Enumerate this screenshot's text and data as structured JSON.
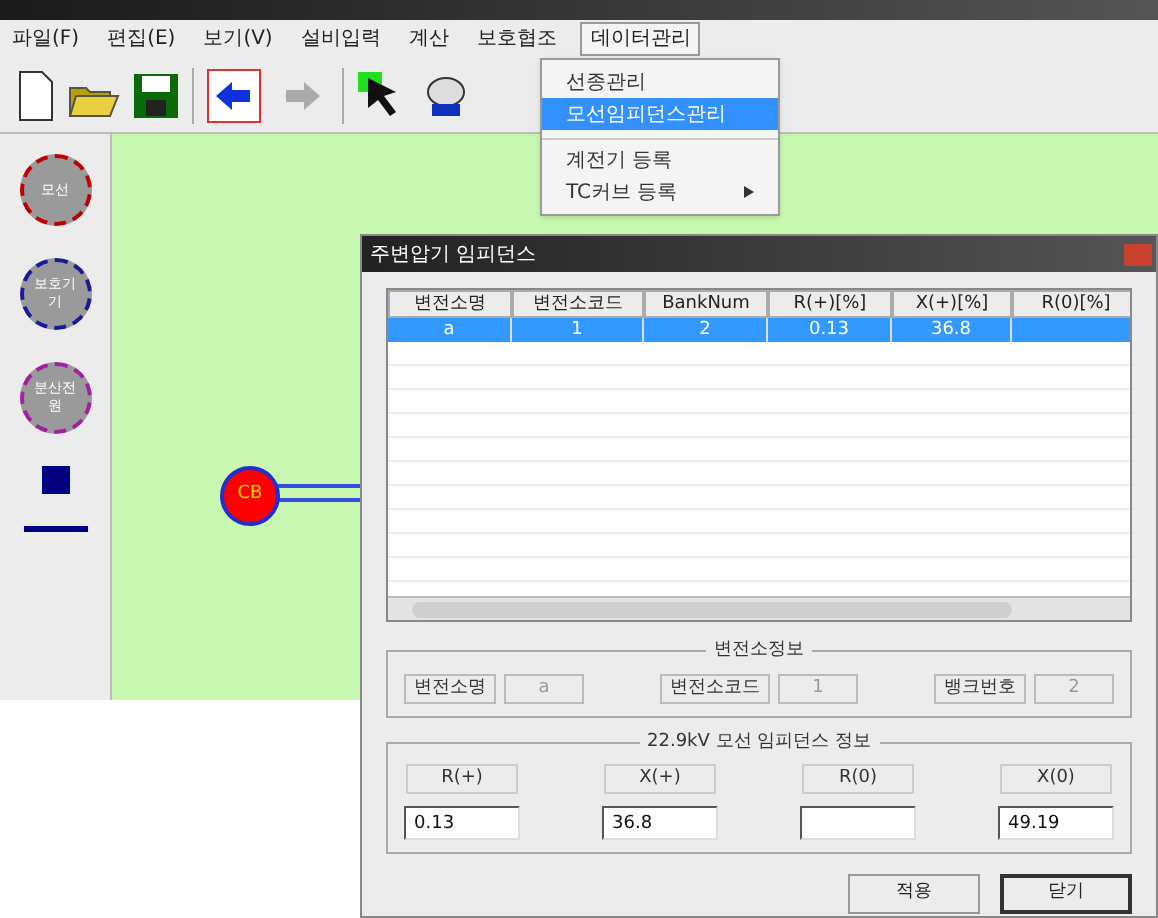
{
  "menu_bar": [
    {
      "label": "파일(F)",
      "selected": false
    },
    {
      "label": "편집(E)",
      "selected": false
    },
    {
      "label": "보기(V)",
      "selected": false
    },
    {
      "label": "설비입력",
      "selected": false
    },
    {
      "label": "계산",
      "selected": false
    },
    {
      "label": "보호협조",
      "selected": false
    },
    {
      "label": "데이터관리",
      "selected": true
    }
  ],
  "dropdown": [
    {
      "label": "선종관리",
      "selected": false,
      "submenu": false
    },
    {
      "label": "모선임피던스관리",
      "selected": true,
      "submenu": false
    },
    {
      "label": "계전기 등록",
      "selected": false,
      "submenu": false
    },
    {
      "label": "TC커브 등록",
      "selected": false,
      "submenu": true
    }
  ],
  "palette": [
    {
      "kind": "circle",
      "label": "모선",
      "color": "#c00000"
    },
    {
      "kind": "circle",
      "label": "보호기기",
      "color": "#1a1a9a"
    },
    {
      "kind": "circle",
      "label": "분산전원",
      "color": "#a020a0"
    },
    {
      "kind": "square"
    },
    {
      "kind": "line"
    }
  ],
  "canvas": {
    "node": "CB"
  },
  "dialog": {
    "title": "주변압기 임피던스",
    "table": {
      "columns": [
        "변전소명",
        "변전소코드",
        "BankNum",
        "R(+)[%]",
        "X(+)[%]",
        "R(0)[%]"
      ],
      "rows": [
        {
          "cells": [
            "a",
            "1",
            "2",
            "0.13",
            "36.8",
            ""
          ],
          "selected": true
        }
      ]
    },
    "station_group": {
      "title": "변전소정보",
      "fields": [
        {
          "label": "변전소명",
          "value": "a",
          "disabled": true
        },
        {
          "label": "변전소코드",
          "value": "1",
          "disabled": true
        },
        {
          "label": "뱅크번호",
          "value": "2",
          "disabled": true
        }
      ]
    },
    "impedance_group": {
      "title": "22.9kV 모선 임피던스 정보",
      "fields": [
        {
          "label": "R(+)",
          "value": "0.13"
        },
        {
          "label": "X(+)",
          "value": "36.8"
        },
        {
          "label": "R(0)"
        },
        {
          "label": "X(0)",
          "value": "49.19"
        }
      ]
    },
    "buttons": [
      {
        "label": "적용",
        "default": false
      },
      {
        "label": "닫기",
        "default": true
      }
    ]
  }
}
